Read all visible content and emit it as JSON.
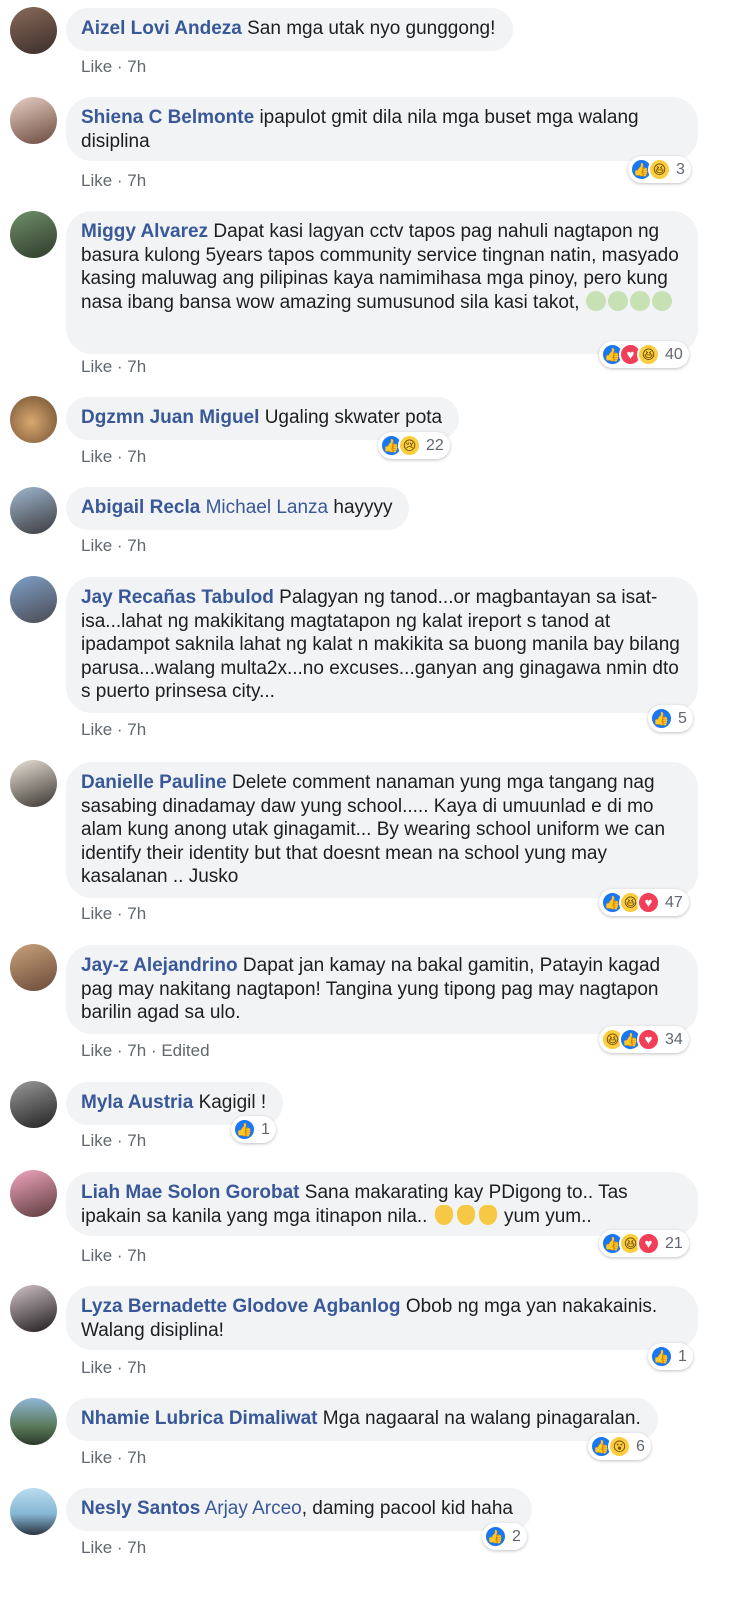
{
  "like_label": "Like",
  "edited_label": "Edited",
  "comments": [
    {
      "author": "Aizel Lovi Andeza",
      "text": "San mga utak nyo gunggong!",
      "time": "7h"
    },
    {
      "author": "Shiena C Belmonte",
      "text": "ipapulot gmit dila nila mga buset mga walang disiplina",
      "time": "7h",
      "reaction_count": "3"
    },
    {
      "author": "Miggy Alvarez",
      "text": "Dapat kasi lagyan cctv tapos pag nahuli nagtapon ng basura kulong 5years tapos community service tingnan natin, masyado kasing maluwag ang pilipinas kaya namimihasa mga pinoy, pero kung nasa ibang bansa wow amazing sumusunod sila kasi takot,",
      "time": "7h",
      "reaction_count": "40"
    },
    {
      "author": "Dgzmn Juan Miguel",
      "text": "Ugaling skwater pota",
      "time": "7h",
      "reaction_count": "22"
    },
    {
      "author": "Abigail Recla",
      "tag": "Michael Lanza",
      "text": "hayyyy",
      "time": "7h"
    },
    {
      "author": "Jay Recañas Tabulod",
      "text": "Palagyan ng tanod...or magbantayan sa isat-isa...lahat ng makikitang magtatapon ng kalat ireport s tanod at ipadampot saknila lahat ng kalat n makikita sa buong manila bay bilang parusa...walang multa2x...no excuses...ganyan ang ginagawa nmin dto s puerto prinsesa city...",
      "time": "7h",
      "reaction_count": "5"
    },
    {
      "author": "Danielle Pauline",
      "text": "Delete comment nanaman yung mga tangang nag sasabing dinadamay daw yung school..... Kaya di umuunlad e di mo alam kung anong utak ginagamit... By wearing school uniform we can identify their identity but that doesnt mean na school yung may kasalanan .. Jusko",
      "time": "7h",
      "reaction_count": "47"
    },
    {
      "author": "Jay-z Alejandrino",
      "text": "Dapat jan kamay na bakal gamitin, Patayin kagad pag may nakitang nagtapon! Tangina yung tipong pag may nagtapon barilin agad sa ulo.",
      "time": "7h",
      "reaction_count": "34"
    },
    {
      "author": "Myla Austria",
      "text": "Kagigil !",
      "time": "7h",
      "reaction_count": "1"
    },
    {
      "author": "Liah Mae Solon Gorobat",
      "text": "Sana makarating kay PDigong to.. Tas ipakain sa kanila yang mga itinapon nila..",
      "text_after": "yum yum..",
      "time": "7h",
      "reaction_count": "21"
    },
    {
      "author": "Lyza Bernadette Glodove Agbanlog",
      "text": "Obob ng mga yan nakakainis. Walang disiplina!",
      "time": "7h",
      "reaction_count": "1"
    },
    {
      "author": "Nhamie Lubrica Dimaliwat",
      "text": "Mga nagaaral na walang pinagaralan.",
      "time": "7h",
      "reaction_count": "6"
    },
    {
      "author": "Nesly Santos",
      "tag": "Arjay Arceo",
      "text": ", daming pacool kid haha",
      "time": "7h",
      "reaction_count": "2"
    }
  ],
  "icons": {
    "like": "thumbs-up-icon",
    "haha": "laughing-face-icon",
    "love": "heart-icon",
    "sad": "crying-face-icon",
    "wow": "surprised-face-icon",
    "facepalm": "facepalm-emoji-icon",
    "ok": "ok-hand-emoji-icon"
  },
  "colors": {
    "name": "#385898",
    "bubble": "#f2f3f5",
    "meta": "#606770",
    "like": "#1877f2",
    "love": "#f33e58",
    "haha": "#fbcd3f"
  }
}
